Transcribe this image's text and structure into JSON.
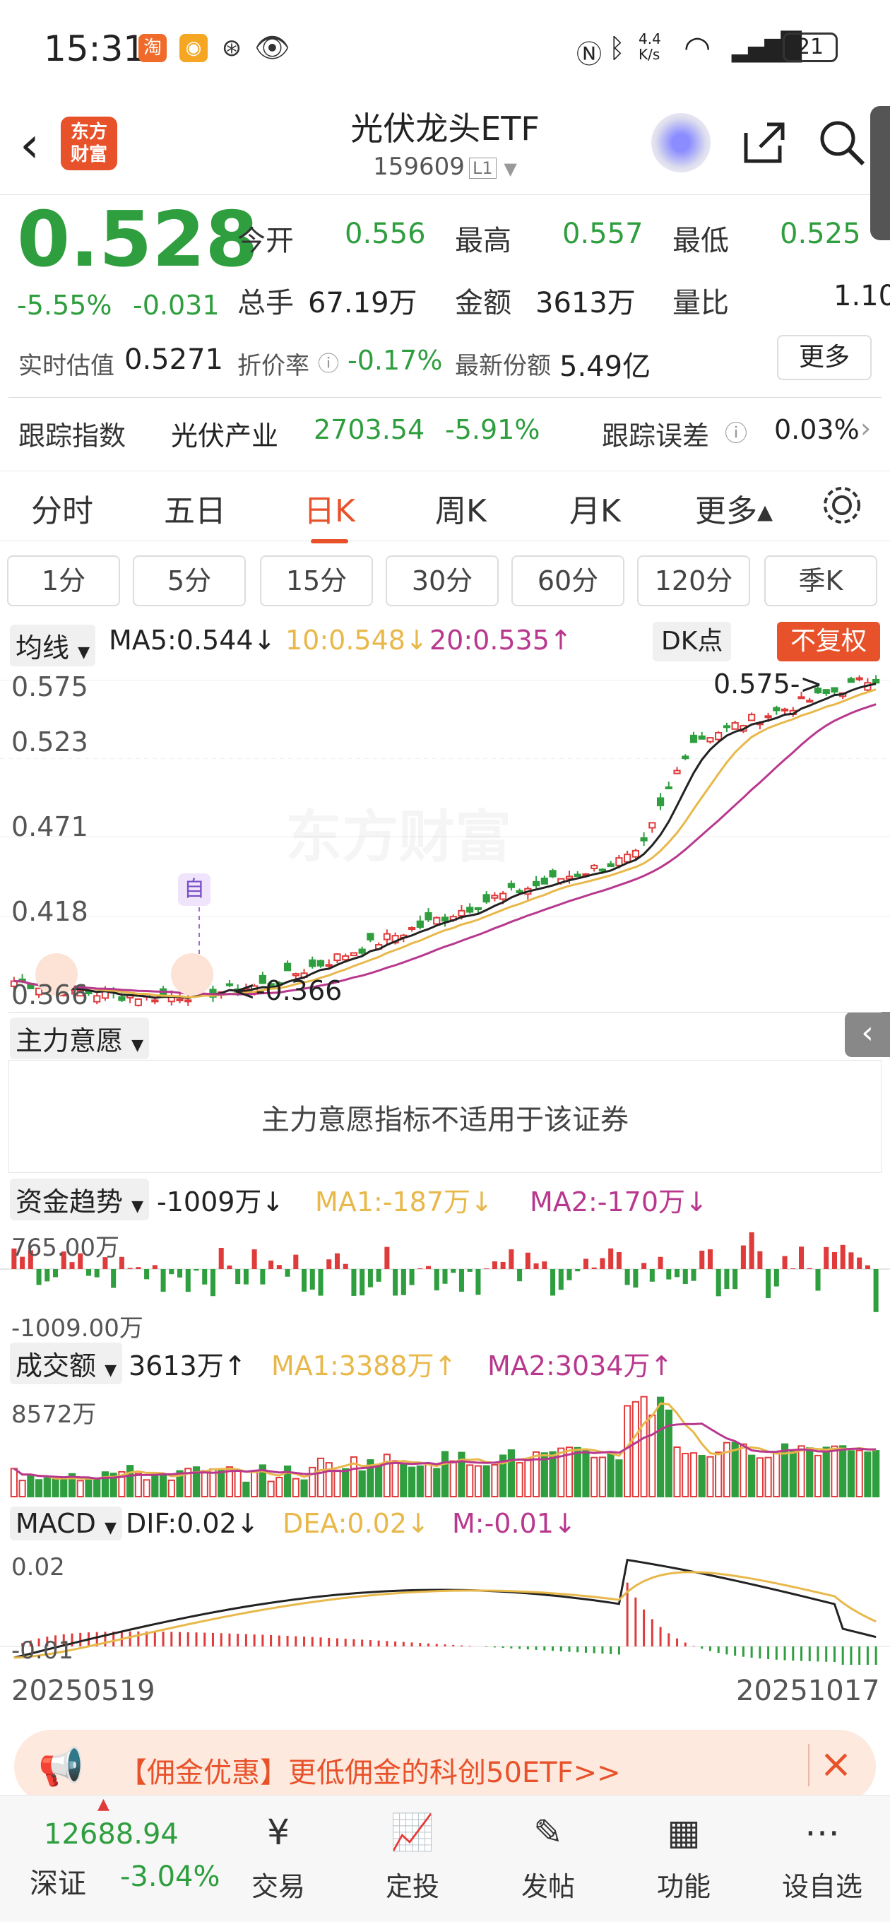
{
  "status_bar": {
    "time": "15:31",
    "net_speed": "4.4 K/s",
    "battery": "21"
  },
  "header": {
    "logo_text": "东方 财富",
    "title": "光伏龙头ETF",
    "code": "159609",
    "market_tag": "L1"
  },
  "quote": {
    "price": "0.528",
    "change_pct": "-5.55%",
    "change": "-0.031",
    "open_label": "今开",
    "open": "0.556",
    "high_label": "最高",
    "high": "0.557",
    "low_label": "最低",
    "low": "0.525",
    "volume_label": "总手",
    "volume": "67.19万",
    "amount_label": "金额",
    "amount": "3613万",
    "ratio_label": "量比",
    "ratio": "1.10",
    "iopv_label": "实时估值",
    "iopv": "0.5271",
    "premium_label": "折价率",
    "premium": "-0.17%",
    "shares_label": "最新份额",
    "shares": "5.49亿",
    "more": "更多"
  },
  "tracking": {
    "label": "跟踪指数",
    "index_name": "光伏产业",
    "index_value": "2703.54",
    "index_change": "-5.91%",
    "error_label": "跟踪误差",
    "error": "0.03%"
  },
  "tabs": [
    "分时",
    "五日",
    "日K",
    "周K",
    "月K",
    "更多▴"
  ],
  "periods": [
    "1分",
    "5分",
    "15分",
    "30分",
    "60分",
    "120分",
    "季K"
  ],
  "kline_header": {
    "ma_label": "均线",
    "ma5": "MA5:0.544↓",
    "ma10": "10:0.548↓",
    "ma20": "20:0.535↑",
    "dk": "DK点",
    "fq": "不复权"
  },
  "colors": {
    "up": "#e03b3b",
    "down": "#2e9e3e",
    "ma5": "#222222",
    "ma10": "#e8b84a",
    "ma20": "#b8388e",
    "accent": "#e8522a"
  },
  "kline_axis": {
    "y1": "0.575",
    "y2": "0.523",
    "y3": "0.471",
    "y4": "0.418",
    "y5": "0.366",
    "max_mark": "0.575->",
    "min_mark": "<-0.366",
    "self_tag": "自",
    "watermark": "东方财富"
  },
  "zhuli": {
    "label": "主力意愿",
    "message": "主力意愿指标不适用于该证券"
  },
  "fund": {
    "label": "资金趋势",
    "value": "-1009万↓",
    "ma1": "MA1:-187万↓",
    "ma2": "MA2:-170万↓",
    "ytop": "765.00万",
    "ybot": "-1009.00万"
  },
  "amount_panel": {
    "label": "成交额",
    "value": "3613万↑",
    "ma1": "MA1:3388万↑",
    "ma2": "MA2:3034万↑",
    "ytop": "8572万"
  },
  "macd": {
    "label": "MACD",
    "dif": "DIF:0.02↓",
    "dea": "DEA:0.02↓",
    "m": "M:-0.01↓",
    "ytop": "0.02",
    "ybot": "-0.01"
  },
  "dates": {
    "start": "20250519",
    "end": "20251017"
  },
  "promo": {
    "text": "【佣金优惠】更低佣金的科创50ETF>>"
  },
  "bottom_bar": {
    "index_value": "12688.94",
    "index_name": "深证",
    "index_change": "-3.04%",
    "items": [
      "交易",
      "定投",
      "发帖",
      "功能",
      "设自选"
    ]
  }
}
